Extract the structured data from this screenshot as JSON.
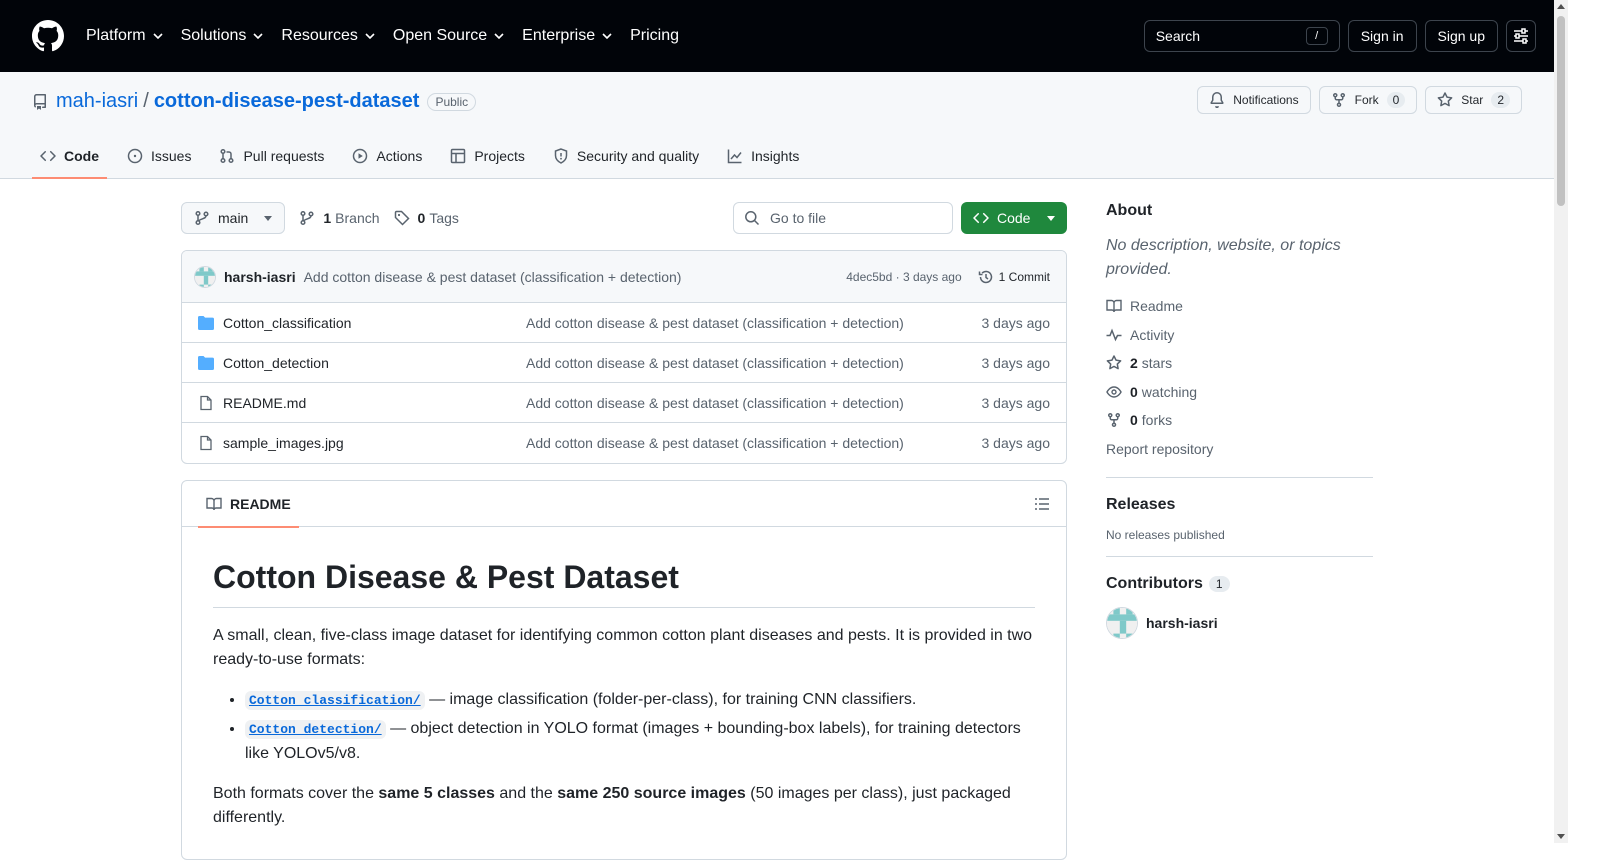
{
  "colors": {
    "header_bg": "#010409",
    "link": "#0969da",
    "accent_tab": "#fd8c73",
    "code_button": "#1f883d"
  },
  "topnav": {
    "items": [
      "Platform",
      "Solutions",
      "Resources",
      "Open Source",
      "Enterprise",
      "Pricing"
    ],
    "search_label": "Search",
    "search_shortcut": "/",
    "sign_in": "Sign in",
    "sign_up": "Sign up"
  },
  "repo": {
    "owner": "mah-iasri",
    "name": "cotton-disease-pest-dataset",
    "visibility": "Public",
    "notifications": "Notifications",
    "fork_label": "Fork",
    "fork_count": "0",
    "star_label": "Star",
    "star_count": "2"
  },
  "tabs": [
    "Code",
    "Issues",
    "Pull requests",
    "Actions",
    "Projects",
    "Security and quality",
    "Insights"
  ],
  "filenav": {
    "branch": "main",
    "branch_count": "1",
    "branch_label": "Branch",
    "tag_count": "0",
    "tag_label": "Tags",
    "goto_placeholder": "Go to file",
    "code_button": "Code"
  },
  "commit": {
    "author": "harsh-iasri",
    "message": "Add cotton disease & pest dataset (classification + detection)",
    "meta": "4dec5bd · 3 days ago",
    "count": "1 Commit"
  },
  "files": [
    {
      "name": "Cotton_classification",
      "type": "folder",
      "message": "Add cotton disease & pest dataset (classification + detection)",
      "date": "3 days ago"
    },
    {
      "name": "Cotton_detection",
      "type": "folder",
      "message": "Add cotton disease & pest dataset (classification + detection)",
      "date": "3 days ago"
    },
    {
      "name": "README.md",
      "type": "file",
      "message": "Add cotton disease & pest dataset (classification + detection)",
      "date": "3 days ago"
    },
    {
      "name": "sample_images.jpg",
      "type": "file",
      "message": "Add cotton disease & pest dataset (classification + detection)",
      "date": "3 days ago"
    }
  ],
  "readme": {
    "tab_label": "README",
    "title": "Cotton Disease & Pest Dataset",
    "intro": "A small, clean, five-class image dataset for identifying common cotton plant diseases and pests. It is provided in two ready-to-use formats:",
    "bullets": [
      {
        "code": "Cotton_classification/",
        "text": " — image classification (folder-per-class), for training CNN classifiers."
      },
      {
        "code": "Cotton_detection/",
        "text": " — object detection in YOLO format (images + bounding-box labels), for training detectors like YOLOv5/v8."
      }
    ],
    "formats_p": {
      "a": "Both formats cover the ",
      "b": "same 5 classes",
      "c": " and the ",
      "d": "same 250 source images",
      "e": " (50 images per class), just packaged differently."
    }
  },
  "sidebar": {
    "about_title": "About",
    "about_desc": "No description, website, or topics provided.",
    "readme": "Readme",
    "activity": "Activity",
    "stars_count": "2",
    "stars_label": "stars",
    "watching_count": "0",
    "watching_label": "watching",
    "forks_count": "0",
    "forks_label": "forks",
    "report": "Report repository",
    "releases_title": "Releases",
    "releases_text": "No releases published",
    "contributors_title": "Contributors",
    "contributors_count": "1",
    "contributor_name": "harsh-iasri"
  }
}
